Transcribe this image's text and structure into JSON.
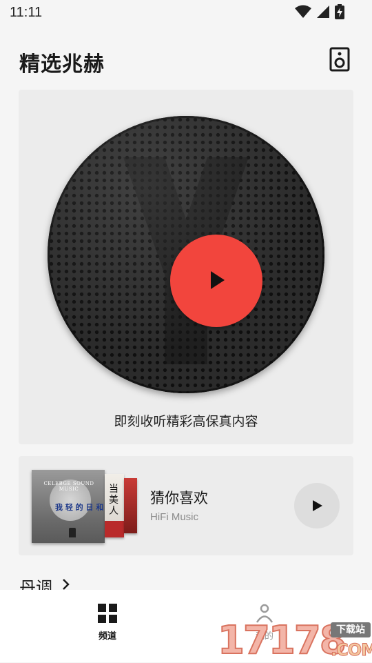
{
  "status_bar": {
    "time": "11:11",
    "icons": [
      "wifi-icon",
      "cell-signal-icon",
      "battery-charging-icon"
    ]
  },
  "header": {
    "title": "精选兆赫",
    "action_icon": "speaker-icon"
  },
  "hero": {
    "caption": "即刻收听精彩高保真内容",
    "play_icon": "play-icon",
    "accent_color": "#f2453d"
  },
  "recommendation": {
    "title": "猜你喜欢",
    "subtitle": "HiFi Music",
    "album_art": {
      "english_text": "CELEBGE SOUND MUSIC",
      "chinese_text": "我 轻 的 日 和",
      "second_cover_text": "当 美 人"
    }
  },
  "section": {
    "title": "丹调"
  },
  "tab_bar": {
    "tabs": [
      {
        "label": "频道",
        "icon": "grid-icon",
        "active": true
      },
      {
        "label": "我的",
        "icon": "person-icon",
        "active": false
      }
    ]
  },
  "watermark": {
    "digits": "17178",
    "badge": "下载站",
    "domain": ".COM"
  }
}
